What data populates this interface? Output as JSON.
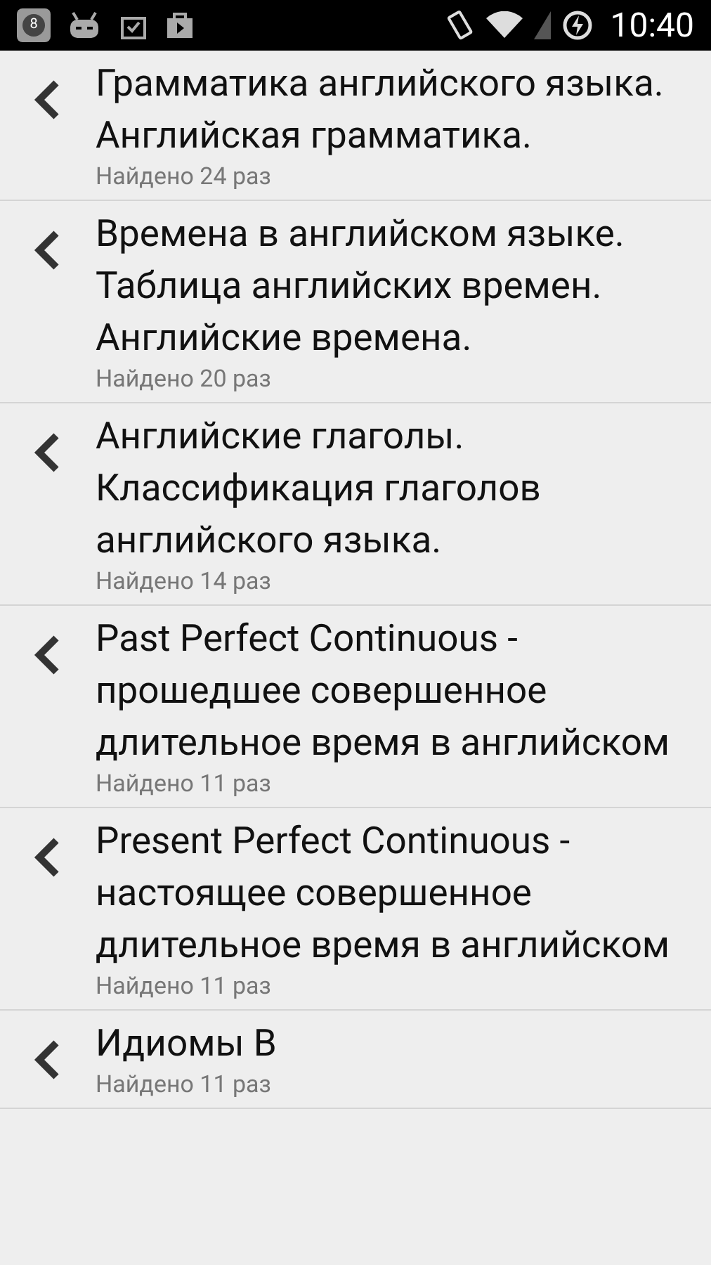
{
  "status_bar": {
    "notification_count": "8",
    "time": "10:40"
  },
  "results": [
    {
      "title": "Грамматика английского языка. Английская грамматика.",
      "found": "Найдено 24 раз"
    },
    {
      "title": "Времена в английском языке. Таблица английских времен. Английские времена.",
      "found": "Найдено 20 раз"
    },
    {
      "title": "Английские глаголы. Классификация глаголов английского языка.",
      "found": "Найдено 14 раз"
    },
    {
      "title": "Past Perfect Continuous - прошедшее совершенное длительное время в английском",
      "found": "Найдено 11 раз"
    },
    {
      "title": "Present Perfect Continuous - настоящее совершенное длительное время в английском",
      "found": "Найдено 11 раз"
    },
    {
      "title": "Идиомы B",
      "found": "Найдено 11 раз"
    }
  ]
}
